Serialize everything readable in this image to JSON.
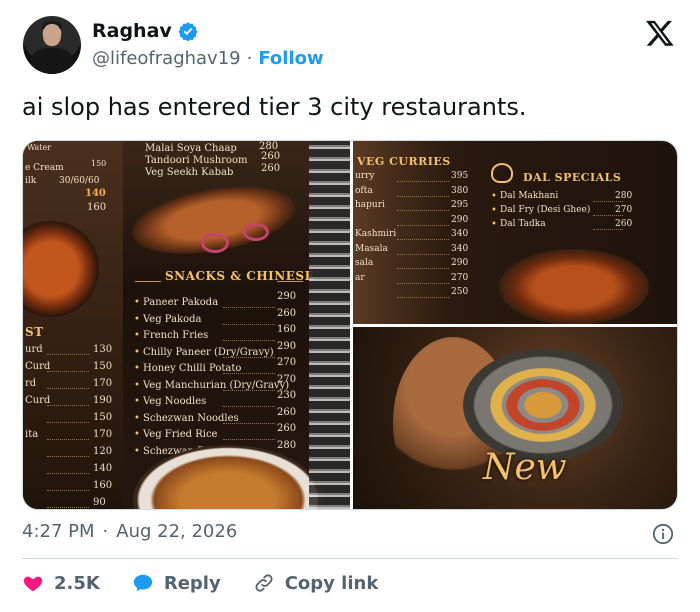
{
  "author": {
    "name": "Raghav",
    "handle": "@lifeofraghav19",
    "separator": "·",
    "follow_label": "Follow"
  },
  "tweet": {
    "text": "ai slop has entered tier 3 city restaurants."
  },
  "media": {
    "left_panel": {
      "top_items": [
        {
          "name": "Malai Soya Chaap",
          "price": "280"
        },
        {
          "name": "Tandoori Mushroom",
          "price": "260"
        },
        {
          "name": "Veg Seekh Kabab",
          "price": "260"
        }
      ],
      "left_edge": [
        {
          "name": "Water",
          "price": ""
        },
        {
          "name": "e Cream",
          "price": "150"
        },
        {
          "name": "ilk",
          "price": "30/60/60"
        },
        {
          "name": "",
          "price": "140"
        },
        {
          "name": "",
          "price": "160"
        }
      ],
      "snacks_title": "SNACKS & CHINESE",
      "snacks": [
        {
          "name": "Paneer Pakoda",
          "price": "290"
        },
        {
          "name": "Veg Pakoda",
          "price": "260"
        },
        {
          "name": "French Fries",
          "price": "160"
        },
        {
          "name": "Chilly Paneer (Dry/Gravy)",
          "price": "290"
        },
        {
          "name": "Honey Chilli Potato",
          "price": "270"
        },
        {
          "name": "Veg Manchurian (Dry/Gravy)",
          "price": "270"
        },
        {
          "name": "Veg Noodles",
          "price": "230"
        },
        {
          "name": "Schezwan Noodles",
          "price": "260"
        },
        {
          "name": "Veg Fried Rice",
          "price": "260"
        },
        {
          "name": "Schezwan Rice",
          "price": "280"
        }
      ],
      "side_title": "ST",
      "side_items": [
        {
          "name": "urd",
          "price": "130"
        },
        {
          "name": "Curd",
          "price": "150"
        },
        {
          "name": "rd",
          "price": "170"
        },
        {
          "name": "Curd",
          "price": "190"
        },
        {
          "name": "",
          "price": "150"
        },
        {
          "name": "ita",
          "price": "170"
        },
        {
          "name": "",
          "price": "120"
        },
        {
          "name": "",
          "price": "140"
        },
        {
          "name": "",
          "price": "160"
        },
        {
          "name": "",
          "price": "90"
        }
      ]
    },
    "top_right_panel": {
      "veg_title": "VEG CURRIES",
      "veg_items": [
        {
          "name": "urry",
          "price": "395"
        },
        {
          "name": "ofta",
          "price": "380"
        },
        {
          "name": "hapuri",
          "price": "295"
        },
        {
          "name": "",
          "price": "290"
        },
        {
          "name": "Kashmiri",
          "price": "340"
        },
        {
          "name": "Masala",
          "price": "340"
        },
        {
          "name": "sala",
          "price": "290"
        },
        {
          "name": "ar",
          "price": "270"
        },
        {
          "name": "",
          "price": "250"
        }
      ],
      "dal_title": "DAL SPECIALS",
      "dal_items": [
        {
          "name": "Dal Makhani",
          "price": "280"
        },
        {
          "name": "Dal Fry (Desi Ghee)",
          "price": "270"
        },
        {
          "name": "Dal Tadka",
          "price": "260"
        }
      ]
    },
    "bottom_right_panel": {
      "new_label": "New"
    }
  },
  "meta": {
    "time": "4:27 PM",
    "separator": "·",
    "date": "Aug 22, 2026"
  },
  "actions": {
    "likes": "2.5K",
    "reply_label": "Reply",
    "copy_label": "Copy link"
  },
  "colors": {
    "accent": "#1d9bf0",
    "like": "#f91880",
    "text": "#0f1419",
    "muted": "#536471"
  }
}
